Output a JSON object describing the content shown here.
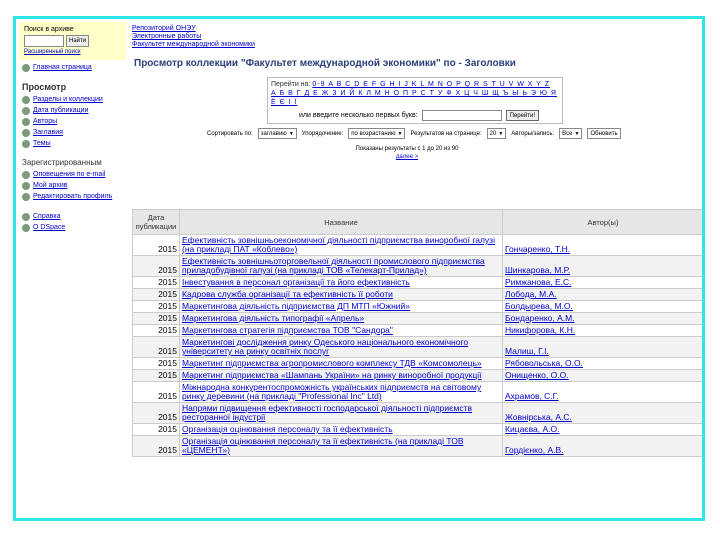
{
  "sidebar": {
    "search_title": "Поиск в архиве",
    "search_button": "Найти",
    "advanced_link": "Расширенный поиск",
    "home_link": "Главная страница",
    "browse_heading": "Просмотр",
    "browse_items": [
      "Разделы и коллекции",
      "Дата публикации",
      "Авторы",
      "Заглавия",
      "Темы"
    ],
    "registered_heading": "Зарегистрированным",
    "registered_items": [
      "Оповещения по e-mail",
      "Мой архив",
      "Редактировать профиль"
    ],
    "extra_items": [
      "Справка",
      "О DSpace"
    ]
  },
  "breadcrumbs": [
    "Репозиторий ОНЭУ",
    "Электронные работы",
    "Факультет международной экономики"
  ],
  "page_title": "Просмотр коллекции \"Факультет международной экономики\" по - Заголовки",
  "alphabet": {
    "goto_label": "Перейти на:",
    "latin": "0-9 A B C D E F G H I J K L M N O P Q R S T U V W X Y Z",
    "cyrillic": "А Б В Г Д Е Ж З И Й К Л М Н О П Р С Т У Ф Х Ц Ч Ш Щ Ъ Ы Ь Э Ю Я Ё Є І Ї",
    "first_letters_label": "или введите несколько первых букв:",
    "go_button": "Перейти!"
  },
  "sortbar": {
    "sort_label": "Сортировать по:",
    "sort_value": "заглавию",
    "order_label": "Упорядочение:",
    "order_value": "по возрастанию",
    "results_label": "Результатов на странице:",
    "results_value": "20",
    "authors_label": "Авторы/запись:",
    "authors_value": "Все",
    "refresh_button": "Обновить"
  },
  "info": {
    "text": "Показаны результаты с 1 до 20 из 90",
    "next": "далее >"
  },
  "table": {
    "headers": [
      "Дата публикации",
      "Название",
      "Автор(ы)"
    ],
    "rows": [
      {
        "year": "2015",
        "title": "Ефективність зовнішньоекономічної діяльності підприємства виноробної галузі (на прикладі ПАТ «Коблево»)",
        "author": "Гончаренко, Т.Н."
      },
      {
        "year": "2015",
        "title": "Ефективність зовнішньоторговельної діяльності промислового підприємства приладобудівної галузі (на прикладі ТОВ «Телекарт-Прилад»)",
        "author": "Шинкарова, М.Р."
      },
      {
        "year": "2015",
        "title": "Інвестування в персонал організації та його ефективність",
        "author": "Римжанова, Е.С."
      },
      {
        "year": "2015",
        "title": "Кадрова служба організації та ефективність її роботи",
        "author": "Лобода, М.А."
      },
      {
        "year": "2015",
        "title": "Маркетингова діяльність підприємства ДП МТП «Южний»",
        "author": "Болдырева, М.О."
      },
      {
        "year": "2015",
        "title": "Маркетингова діяльність типографії «Апрель»",
        "author": "Бондаренко, А.М."
      },
      {
        "year": "2015",
        "title": "Маркетингова стратегія підприємства ТОВ \"Сандора\"",
        "author": "Никифорова, К.Н."
      },
      {
        "year": "2015",
        "title": "Маркетингові дослідження ринку Одеського національного економічного університету на ринку освітніх послуг",
        "author": "Малиш, Г.І."
      },
      {
        "year": "2015",
        "title": "Маркетинг підприємства агропромислового комплексу ТДВ «Комсомолець»",
        "author": "Рябовольська, О.О."
      },
      {
        "year": "2015",
        "title": "Маркетинг підприємства «Шампань України» на ринку виноробної продукції",
        "author": "Онищенко, О.О."
      },
      {
        "year": "2015",
        "title": "Міжнародна конкурентоспроможність українських підприємств на світовому ринку деревини (на прикладі \"Professional Inc\" Ltd)",
        "author": "Ахрамов, С.Г."
      },
      {
        "year": "2015",
        "title": "Напрями підвищення ефективності господарської діяльності підприємств ресторанної індустрії",
        "author": "Жовнірська, А.С."
      },
      {
        "year": "2015",
        "title": "Організація оцінювання персоналу та її ефективність",
        "author": "Кицаєва, А.О."
      },
      {
        "year": "2015",
        "title": "Організація оцінювання персоналу та її ефективність (на прикладі ТОВ «ЦЕМЕНТ»)",
        "author": "Гордієнко, А.В."
      }
    ]
  }
}
